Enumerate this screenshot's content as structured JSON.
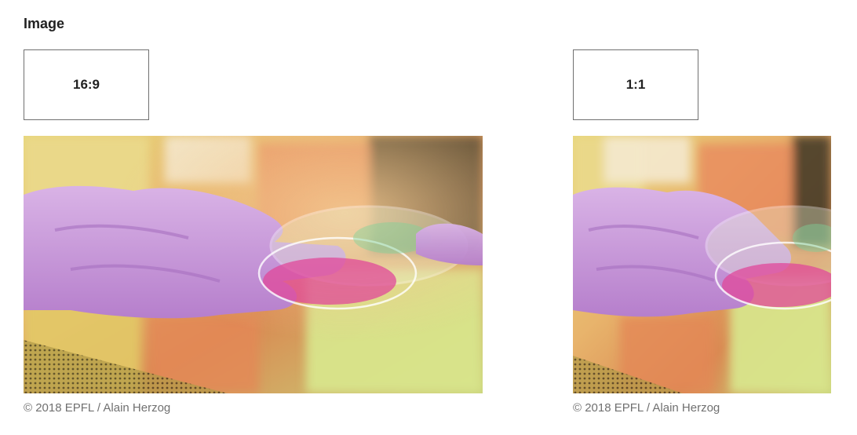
{
  "section": {
    "title": "Image"
  },
  "variants": [
    {
      "ratio_label": "16:9",
      "credit": "© 2018 EPFL / Alain Herzog"
    },
    {
      "ratio_label": "1:1",
      "credit": "© 2018 EPFL / Alain Herzog"
    }
  ],
  "photo": {
    "subject": "gloved-hand-holding-petri-dish",
    "colors": {
      "glove": "#c99ad8",
      "background_warm": "#e9b86a",
      "background_green": "#d7e28a",
      "dish_pink": "#e0489a"
    }
  }
}
